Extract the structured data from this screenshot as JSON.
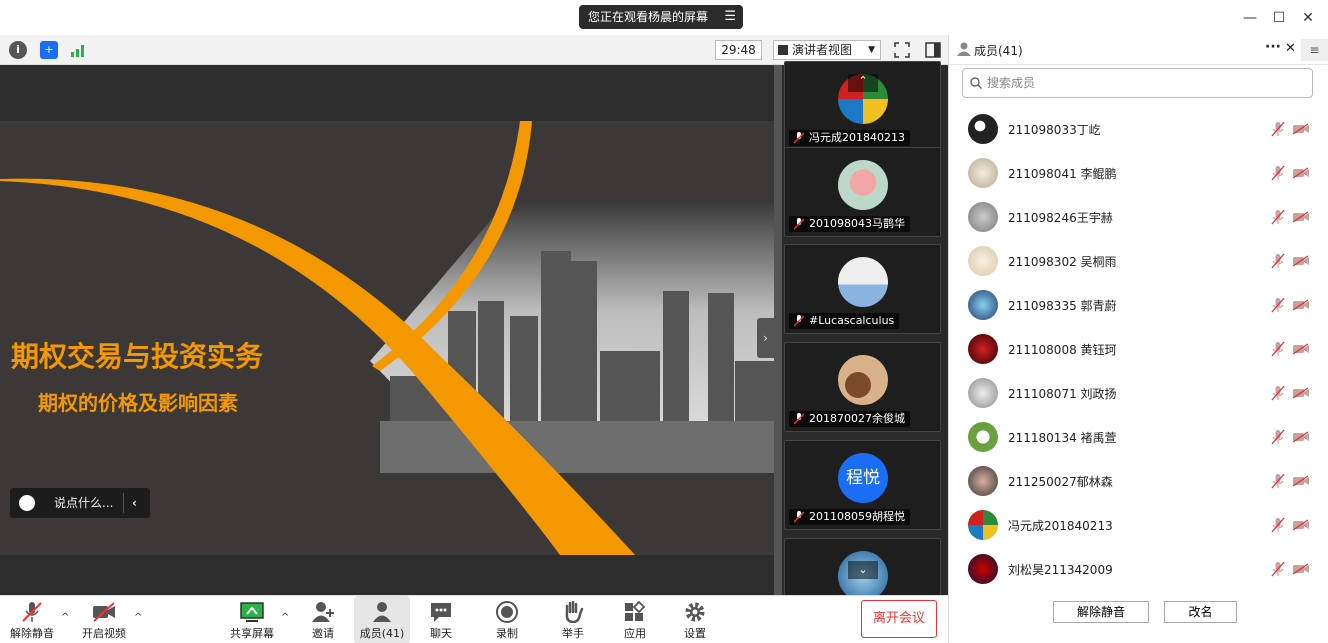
{
  "titlebar": {
    "sharing_text": "您正在观看杨晨的屏幕"
  },
  "toolbar": {
    "timer": "29:48",
    "view_mode": "演讲者视图"
  },
  "slide": {
    "title": "期权交易与投资实务",
    "subtitle": "期权的价格及影响因素"
  },
  "chat": {
    "placeholder": "说点什么..."
  },
  "gallery": {
    "tiles": [
      {
        "name": "冯元成201840213"
      },
      {
        "name": "201098043马鹊华"
      },
      {
        "name": "#Lucascalculus"
      },
      {
        "name": "201870027余俊城"
      },
      {
        "name": "201108059胡程悦",
        "initials": "程悦"
      }
    ]
  },
  "members_panel": {
    "header": "成员(41)",
    "search_placeholder": "搜索成员",
    "members": [
      {
        "name": "211098033丁屹"
      },
      {
        "name": "211098041 李鲲鹏"
      },
      {
        "name": "211098246王宇赫"
      },
      {
        "name": "211098302 吴桐雨"
      },
      {
        "name": "211098335 郭青蔚"
      },
      {
        "name": "211108008 黄钰珂"
      },
      {
        "name": "211108071 刘政扬"
      },
      {
        "name": "211180134 褚禹萱"
      },
      {
        "name": "211250027郁林森"
      },
      {
        "name": "冯元成201840213"
      },
      {
        "name": "刘松昊211342009"
      }
    ],
    "unmute_button": "解除静音",
    "rename_button": "改名"
  },
  "bottom_bar": {
    "unmute": "解除静音",
    "start_video": "开启视频",
    "share_screen": "共享屏幕",
    "invite": "邀请",
    "members": "成员(41)",
    "chat": "聊天",
    "record": "录制",
    "raise_hand": "举手",
    "apps": "应用",
    "settings": "设置",
    "leave": "离开会议"
  },
  "colors": {
    "accent_orange": "#f39800",
    "leave_red": "#e33333",
    "blue": "#1a6ef5"
  }
}
